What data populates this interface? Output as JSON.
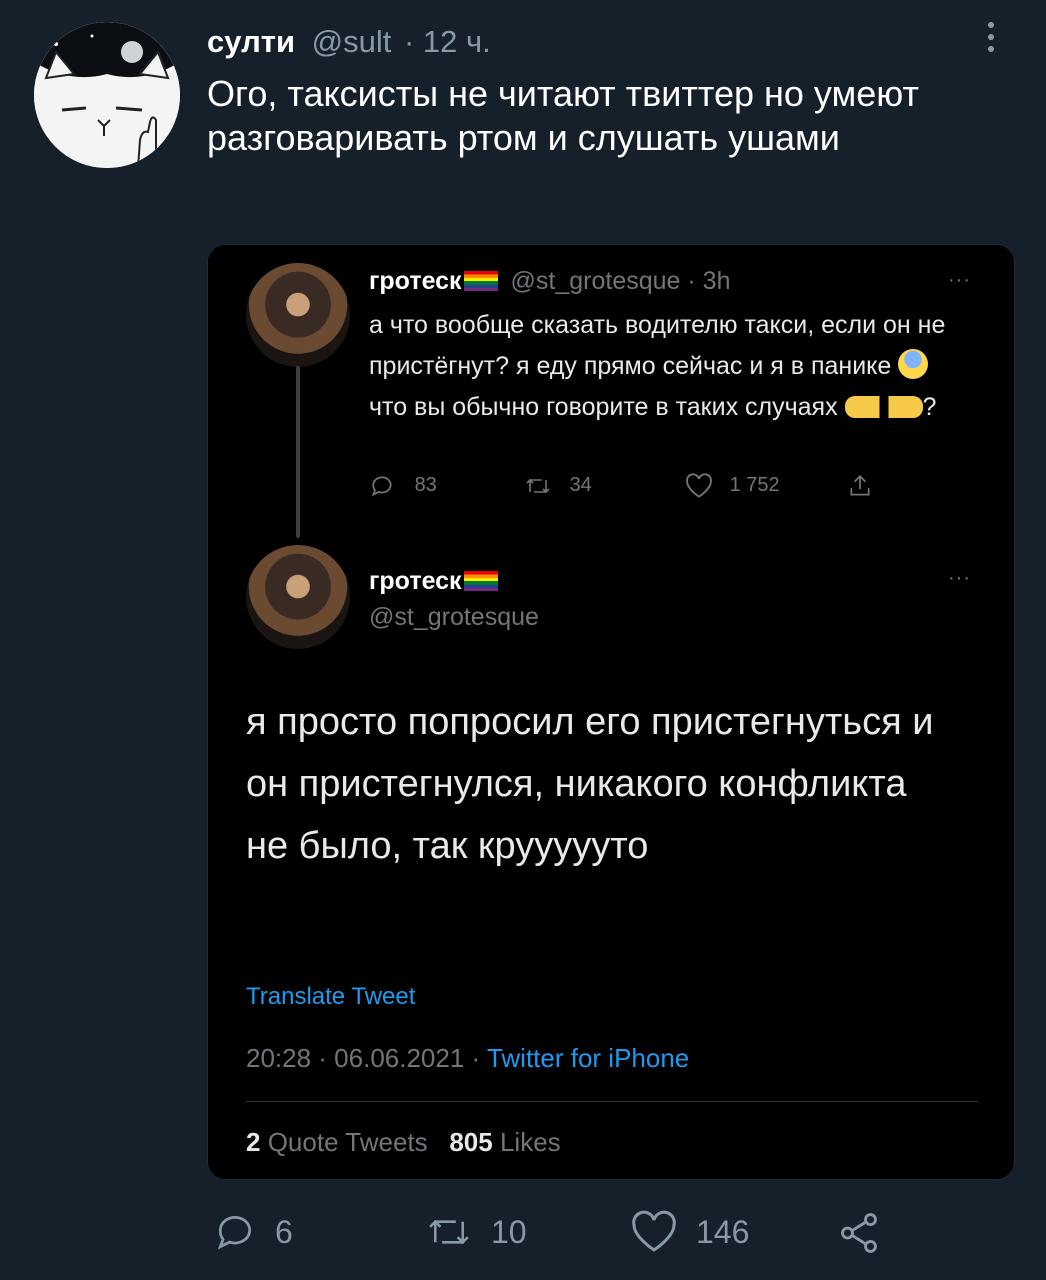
{
  "tweet": {
    "author_name": "султи",
    "handle": "@sult",
    "time": "· 12 ч.",
    "text": "Ого, таксисты не читают твиттер но умеют разговаривать ртом и слушать ушами",
    "replies": "6",
    "retweets": "10",
    "likes": "146"
  },
  "quoted": {
    "reply": {
      "name": "гротеск",
      "handle_time": "@st_grotesque · 3h",
      "text_before_emoji": "а что вообще сказать водителю такси, если он не пристёгнут? я еду прямо сейчас и я в панике",
      "text_mid": "что вы обычно говорите в таких случаях",
      "text_end": "?",
      "replies": "83",
      "retweets": "34",
      "likes": "1 752",
      "more": "···"
    },
    "main": {
      "name": "гротеск",
      "handle": "@st_grotesque",
      "text": "я просто попросил его пристегнуться и он пристегнулся, никакого конфликта не было, так круууууто",
      "translate": "Translate Tweet",
      "datetime": "20:28 · 06.06.2021 ·",
      "source": "Twitter for iPhone",
      "quote_count": "2",
      "quote_label": "Quote Tweets",
      "like_count": "805",
      "like_label": "Likes",
      "more": "···"
    }
  },
  "colors": {
    "background": "#15202b",
    "card": "#000000",
    "muted": "#8899a6",
    "link": "#1d9bf0"
  }
}
